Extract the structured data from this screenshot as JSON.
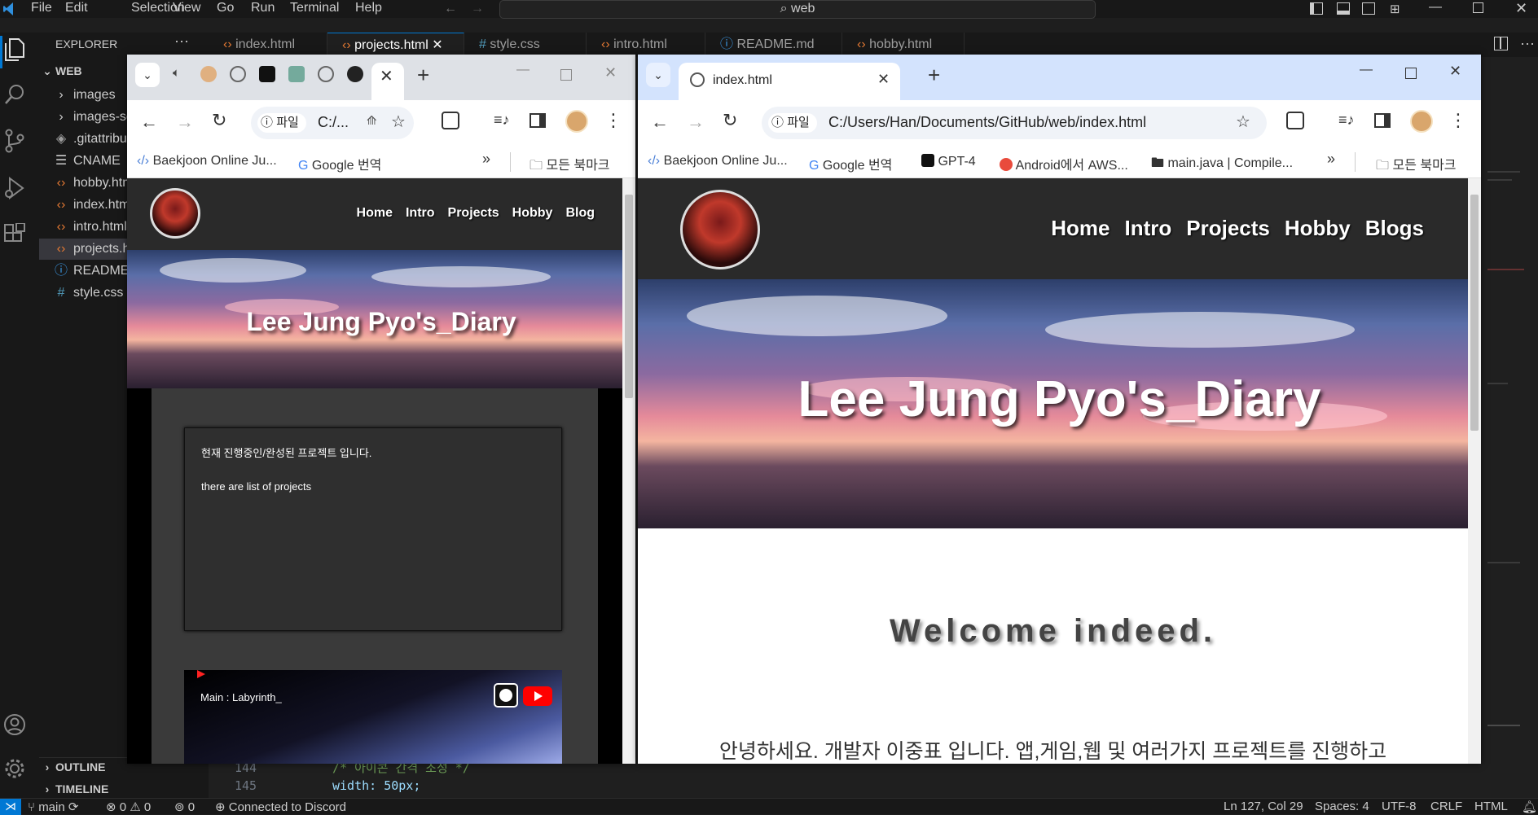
{
  "vscode": {
    "menu": [
      "File",
      "Edit",
      "Selection",
      "View",
      "Go",
      "Run",
      "Terminal",
      "Help"
    ],
    "search": "web",
    "explorer_title": "EXPLORER",
    "root": "WEB",
    "tree": [
      {
        "label": "images",
        "type": "folder"
      },
      {
        "label": "images-sc",
        "type": "folder"
      },
      {
        "label": ".gitattribu",
        "type": "git"
      },
      {
        "label": "CNAME",
        "type": "text"
      },
      {
        "label": "hobby.htm",
        "type": "html"
      },
      {
        "label": "index.htm",
        "type": "html"
      },
      {
        "label": "intro.html",
        "type": "html"
      },
      {
        "label": "projects.h",
        "type": "html"
      },
      {
        "label": "README.r",
        "type": "info"
      },
      {
        "label": "style.css",
        "type": "css"
      }
    ],
    "outline": "OUTLINE",
    "timeline": "TIMELINE",
    "tabs": [
      {
        "label": "index.html",
        "type": "html"
      },
      {
        "label": "projects.html",
        "type": "html",
        "active": true
      },
      {
        "label": "style.css",
        "type": "css"
      },
      {
        "label": "intro.html",
        "type": "html"
      },
      {
        "label": "README.md",
        "type": "info"
      },
      {
        "label": "hobby.html",
        "type": "html"
      }
    ],
    "code_lines": [
      {
        "num": "144",
        "text": "/* 아이콘 간격 조정 */"
      },
      {
        "num": "145",
        "text": "width: 50px;"
      }
    ],
    "status": {
      "branch": "main",
      "problems": "⊗ 0 ⚠ 0",
      "ports": "0",
      "discord": "Connected to Discord",
      "position": "Ln 127, Col 29",
      "spaces": "Spaces: 4",
      "encoding": "UTF-8",
      "eol": "CRLF",
      "language": "HTML"
    }
  },
  "left_browser": {
    "address": "C:/...",
    "file_label": "파일",
    "bookmarks": [
      "Baekjoon Online Ju...",
      "Google 번역"
    ],
    "all_bookmarks": "모든 북마크",
    "page": {
      "nav": [
        "Home",
        "Intro",
        "Projects",
        "Hobby",
        "Blog"
      ],
      "title": "Lee Jung Pyo's_Diary",
      "card_line1": "현재 진행중인/완성된 프로젝트 입니다.",
      "card_line2": "there are list of projects",
      "project_title": "Main : Labyrinth_"
    }
  },
  "right_browser": {
    "tab_title": "index.html",
    "address": "C:/Users/Han/Documents/GitHub/web/index.html",
    "file_label": "파일",
    "bookmarks": [
      "Baekjoon Online Ju...",
      "Google 번역",
      "GPT-4",
      "Android에서 AWS...",
      "main.java | Compile..."
    ],
    "all_bookmarks": "모든 북마크",
    "page": {
      "nav": [
        "Home",
        "Intro",
        "Projects",
        "Hobby",
        "Blogs"
      ],
      "title": "Lee Jung Pyo's_Diary",
      "welcome": "Welcome indeed.",
      "intro_text": "안녕하세요. 개발자 이중표 입니다.   앱,게임,웹 및 여러가지 프로젝트를 진행하고"
    }
  }
}
